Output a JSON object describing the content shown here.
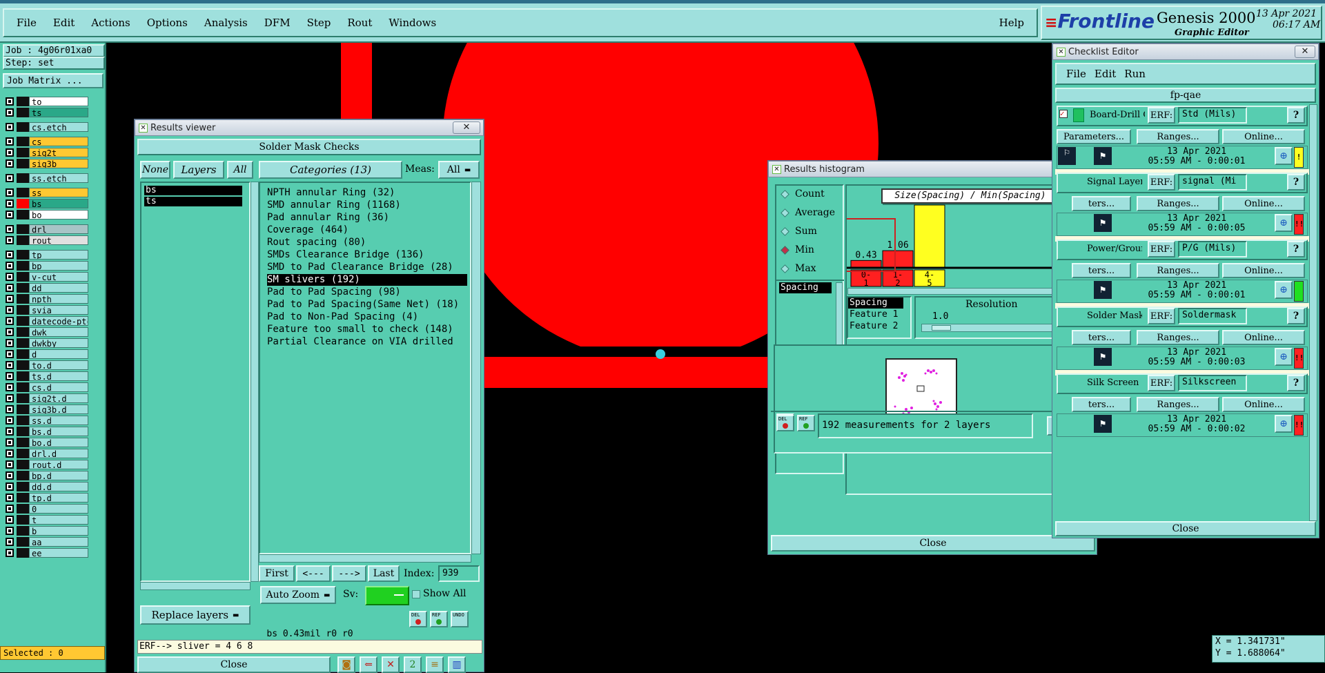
{
  "menu": {
    "items": [
      "File",
      "Edit",
      "Actions",
      "Options",
      "Analysis",
      "DFM",
      "Step",
      "Rout",
      "Windows"
    ],
    "help": "Help"
  },
  "brand": {
    "logo": "Frontline",
    "product": "Genesis 2000",
    "subtitle": "Graphic Editor",
    "date": "13 Apr 2021",
    "time": "06:17 AM"
  },
  "left_panel": {
    "job": "Job : 4g06r01xa0",
    "step": "Step: set",
    "job_matrix": "Job Matrix ...",
    "selected": "Selected : 0",
    "layers": [
      {
        "name": "to",
        "color": "#ffffff",
        "swatch": "#111111"
      },
      {
        "name": "ts",
        "color": "#2aa888",
        "swatch": "#111111"
      },
      {
        "name": "cs.etch",
        "color": "#9fe0dd",
        "swatch": "#111111"
      },
      {
        "name": "cs",
        "color": "#ffc832",
        "swatch": "#111111"
      },
      {
        "name": "sig2t",
        "color": "#ffc832",
        "swatch": "#111111"
      },
      {
        "name": "sig3b",
        "color": "#ffc832",
        "swatch": "#111111"
      },
      {
        "name": "ss.etch",
        "color": "#9fe0dd",
        "swatch": "#111111"
      },
      {
        "name": "ss",
        "color": "#ffc832",
        "swatch": "#111111"
      },
      {
        "name": "bs",
        "color": "#2aa888",
        "swatch": "#ff0000"
      },
      {
        "name": "bo",
        "color": "#ffffff",
        "swatch": "#111111"
      },
      {
        "name": "drl",
        "color": "#a8c4c6",
        "swatch": "#111111"
      },
      {
        "name": "rout",
        "color": "#e0e0e0",
        "swatch": "#111111"
      },
      {
        "name": "tp",
        "color": "#9fe0dd",
        "swatch": "#111111"
      },
      {
        "name": "bp",
        "color": "#9fe0dd",
        "swatch": "#111111"
      },
      {
        "name": "v-cut",
        "color": "#9fe0dd",
        "swatch": "#111111"
      },
      {
        "name": "dd",
        "color": "#9fe0dd",
        "swatch": "#111111"
      },
      {
        "name": "npth",
        "color": "#9fe0dd",
        "swatch": "#111111"
      },
      {
        "name": "svia",
        "color": "#9fe0dd",
        "swatch": "#111111"
      },
      {
        "name": "datecode-ptc",
        "color": "#9fe0dd",
        "swatch": "#111111"
      },
      {
        "name": "dwk",
        "color": "#9fe0dd",
        "swatch": "#111111"
      },
      {
        "name": "dwkby",
        "color": "#9fe0dd",
        "swatch": "#111111"
      },
      {
        "name": "d",
        "color": "#9fe0dd",
        "swatch": "#111111"
      },
      {
        "name": "to.d",
        "color": "#9fe0dd",
        "swatch": "#111111"
      },
      {
        "name": "ts.d",
        "color": "#9fe0dd",
        "swatch": "#111111"
      },
      {
        "name": "cs.d",
        "color": "#9fe0dd",
        "swatch": "#111111"
      },
      {
        "name": "sig2t.d",
        "color": "#9fe0dd",
        "swatch": "#111111"
      },
      {
        "name": "sig3b.d",
        "color": "#9fe0dd",
        "swatch": "#111111"
      },
      {
        "name": "ss.d",
        "color": "#9fe0dd",
        "swatch": "#111111"
      },
      {
        "name": "bs.d",
        "color": "#9fe0dd",
        "swatch": "#111111"
      },
      {
        "name": "bo.d",
        "color": "#9fe0dd",
        "swatch": "#111111"
      },
      {
        "name": "drl.d",
        "color": "#9fe0dd",
        "swatch": "#111111"
      },
      {
        "name": "rout.d",
        "color": "#9fe0dd",
        "swatch": "#111111"
      },
      {
        "name": "bp.d",
        "color": "#9fe0dd",
        "swatch": "#111111"
      },
      {
        "name": "dd.d",
        "color": "#9fe0dd",
        "swatch": "#111111"
      },
      {
        "name": "tp.d",
        "color": "#9fe0dd",
        "swatch": "#111111"
      },
      {
        "name": "0",
        "color": "#9fe0dd",
        "swatch": "#111111"
      },
      {
        "name": "t",
        "color": "#9fe0dd",
        "swatch": "#111111"
      },
      {
        "name": "b",
        "color": "#9fe0dd",
        "swatch": "#111111"
      },
      {
        "name": "aa",
        "color": "#9fe0dd",
        "swatch": "#111111"
      },
      {
        "name": "ee",
        "color": "#9fe0dd",
        "swatch": "#111111"
      }
    ]
  },
  "results_viewer": {
    "title": "Results viewer",
    "header": "Solder Mask Checks",
    "none": "None",
    "layers": "Layers",
    "all": "All",
    "categories_label": "Categories (13)",
    "meas_label": "Meas:",
    "meas_value": "All",
    "layer_list": [
      "bs",
      "ts"
    ],
    "categories": [
      "NPTH annular Ring (32)",
      "SMD annular Ring (1168)",
      "Pad annular Ring (36)",
      "Coverage (464)",
      "Rout spacing (80)",
      "SMDs Clearance Bridge (136)",
      "SMD to Pad Clearance Bridge (28)",
      "SM slivers (192)",
      "Pad to Pad Spacing (98)",
      "Pad to Pad Spacing(Same Net) (18)",
      "Pad to Non-Pad Spacing (4)",
      "Feature too small to check (148)",
      "Partial Clearance on VIA drilled"
    ],
    "selected_category": "SM slivers (192)",
    "first": "First",
    "prev": "<---",
    "next": "--->",
    "last": "Last",
    "index_label": "Index:",
    "index_value": "939",
    "auto_zoom": "Auto Zoom",
    "sv_label": "Sv:",
    "show_all": "Show All",
    "replace_layers": "Replace layers",
    "del": "DEL",
    "ref": "REF",
    "undo": "UNDO",
    "status": "bs 0.43mil  r0  r0",
    "erf": "ERF--> sliver = 4 6 8",
    "close": "Close"
  },
  "histogram": {
    "title": "Results histogram",
    "radios": [
      "Count",
      "Average",
      "Sum",
      "Min",
      "Max"
    ],
    "selected_radio": "Min",
    "chart_title": "Size(Spacing) / Min(Spacing)",
    "list_item": "Spacing",
    "resolution_label": "Resolution",
    "resolution_value": "1.0",
    "legend": [
      "Spacing",
      "Feature 1",
      "Feature 2"
    ],
    "measurements": "192 measurements for 2 layers",
    "close": "Close",
    "del": "DEL",
    "ref": "REF",
    "chart_data": {
      "type": "bar",
      "categories": [
        "0-1",
        "1-2",
        "4-5"
      ],
      "values": [
        0.43,
        1.06,
        4
      ],
      "colors": [
        "#ff2020",
        "#ff2020",
        "#ffff20"
      ]
    }
  },
  "checklist": {
    "title": "Checklist Editor",
    "menu": [
      "File",
      "Edit",
      "Run"
    ],
    "name": "fp-qae",
    "erf_label": "ERF:",
    "parameters": "Parameters...",
    "ranges": "Ranges...",
    "online": "Online...",
    "ters": "ters...",
    "rows": [
      {
        "name": "Board-Drill Che",
        "erf": "Std (Mils)",
        "date": "13 Apr 2021",
        "time": "05:59 AM - 0:00:01",
        "status": "#ffff20",
        "mark": "!"
      },
      {
        "name": "Signal Layer Ch",
        "erf": "signal (Mi",
        "date": "13 Apr 2021",
        "time": "05:59 AM - 0:00:05",
        "status": "#ff2020",
        "mark": "!!"
      },
      {
        "name": "Power/Ground C",
        "erf": "P/G (Mils)",
        "date": "13 Apr 2021",
        "time": "05:59 AM - 0:00:01",
        "status": "#20e020",
        "mark": ""
      },
      {
        "name": "Solder Mask Ch",
        "erf": "Soldermask",
        "date": "13 Apr 2021",
        "time": "05:59 AM - 0:00:03",
        "status": "#ff2020",
        "mark": "!!"
      },
      {
        "name": "Silk Screen Che",
        "erf": "Silkscreen",
        "date": "13 Apr 2021",
        "time": "05:59 AM - 0:00:02",
        "status": "#ff2020",
        "mark": "!!"
      }
    ],
    "close": "Close"
  },
  "coords": {
    "x": "X = 1.341731\"",
    "y": "Y = 1.688064\""
  }
}
